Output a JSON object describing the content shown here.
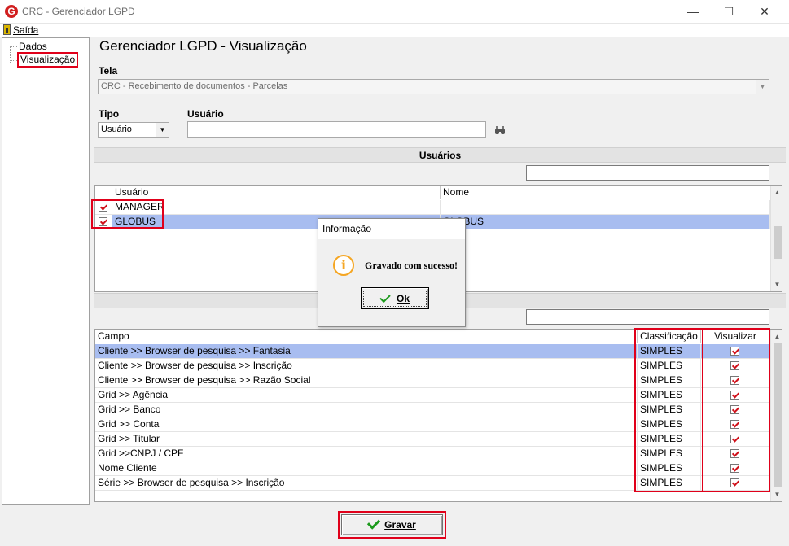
{
  "window": {
    "title": "CRC - Gerenciador LGPD",
    "logo_letter": "G",
    "minimize": "—",
    "maximize": "☐",
    "close": "✕"
  },
  "menu": {
    "saida": "Saída"
  },
  "tree": {
    "items": [
      "Dados",
      "Visualização"
    ]
  },
  "page": {
    "title": "Gerenciador LGPD - Visualização"
  },
  "tela": {
    "label": "Tela",
    "value": "CRC - Recebimento de documentos - Parcelas"
  },
  "tipo": {
    "label": "Tipo",
    "value": "Usuário"
  },
  "usuario": {
    "label": "Usuário",
    "value": ""
  },
  "usuarios_section": {
    "title": "Usuários",
    "search_value": "",
    "columns": [
      "Usuário",
      "Nome"
    ],
    "rows": [
      {
        "usuario": "MANAGER",
        "nome": "",
        "checked": true,
        "selected": false
      },
      {
        "usuario": "GLOBUS",
        "nome": "GLOBUS",
        "checked": true,
        "selected": true
      }
    ]
  },
  "campos_section": {
    "title": "Campo",
    "search_value": "",
    "columns": [
      "Campo",
      "Classificação",
      "Visualizar"
    ],
    "rows": [
      {
        "campo": "Cliente >> Browser de pesquisa >> Fantasia",
        "classificacao": "SIMPLES",
        "visualizar": true
      },
      {
        "campo": "Cliente >> Browser de pesquisa >> Inscrição",
        "classificacao": "SIMPLES",
        "visualizar": true
      },
      {
        "campo": "Cliente >> Browser de pesquisa >> Razão Social",
        "classificacao": "SIMPLES",
        "visualizar": true
      },
      {
        "campo": "Grid >> Agência",
        "classificacao": "SIMPLES",
        "visualizar": true
      },
      {
        "campo": "Grid >> Banco",
        "classificacao": "SIMPLES",
        "visualizar": true
      },
      {
        "campo": "Grid >> Conta",
        "classificacao": "SIMPLES",
        "visualizar": true
      },
      {
        "campo": "Grid >> Titular",
        "classificacao": "SIMPLES",
        "visualizar": true
      },
      {
        "campo": "Grid >>CNPJ / CPF",
        "classificacao": "SIMPLES",
        "visualizar": true
      },
      {
        "campo": "Nome Cliente",
        "classificacao": "SIMPLES",
        "visualizar": true
      },
      {
        "campo": "Série >> Browser de pesquisa >> Inscrição",
        "classificacao": "SIMPLES",
        "visualizar": true
      }
    ]
  },
  "gravar_button": {
    "label": "Gravar"
  },
  "dialog": {
    "title": "Informação",
    "message": "Gravado com sucesso!",
    "ok_label": "Ok",
    "icon_glyph": "i"
  },
  "colors": {
    "selection": "#a8bdf0",
    "highlight_red": "#e0001a",
    "check_green": "#1c9a1c",
    "info_orange": "#f5a623"
  }
}
